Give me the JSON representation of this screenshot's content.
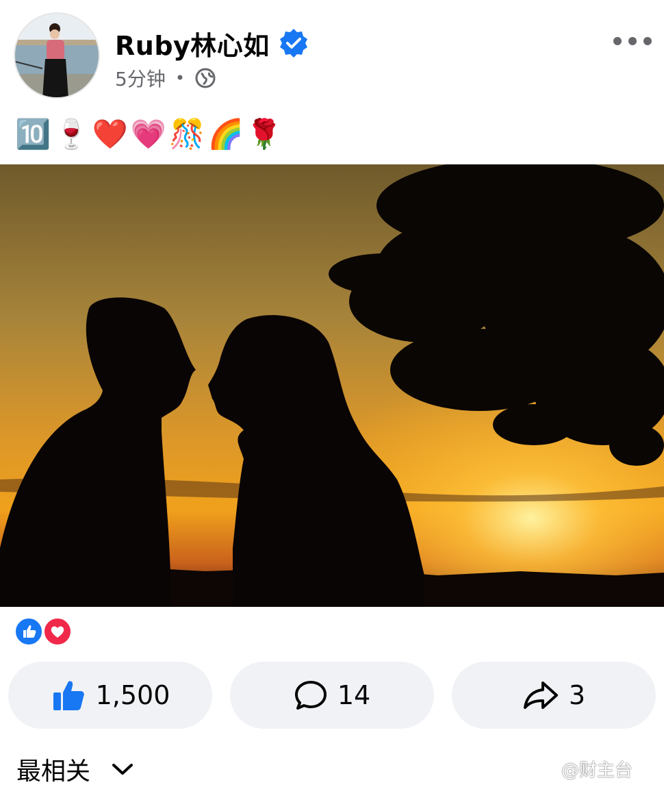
{
  "post": {
    "author": "Ruby林心如",
    "time": "5分钟",
    "separator": "•",
    "caption": "🔟🍷❤️💗🎊🌈🌹",
    "privacy_icon": "globe-icon",
    "verified_icon": "verified-badge-icon",
    "menu_icon": "more-icon"
  },
  "reactions": {
    "types": [
      "like",
      "love"
    ]
  },
  "actions": {
    "like_count": "1,500",
    "comment_count": "14",
    "share_count": "3"
  },
  "comments": {
    "sort_label": "最相关"
  },
  "watermark": "@财主台",
  "colors": {
    "facebook_blue": "#1877f2",
    "love_red": "#f02849",
    "button_bg": "#f0f2f5",
    "secondary_text": "#65676b"
  }
}
